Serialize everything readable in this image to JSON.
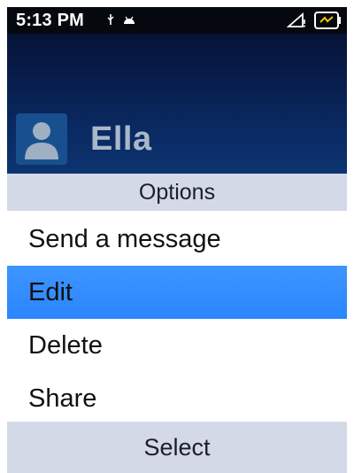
{
  "status_bar": {
    "time": "5:13 PM",
    "icons": [
      "usb-debug-icon",
      "android-icon",
      "signal-icon",
      "battery-charging-icon"
    ]
  },
  "contact": {
    "name": "Ella",
    "avatar_icon": "person-icon"
  },
  "options": {
    "title": "Options"
  },
  "menu": {
    "items": [
      {
        "label": "Send a message",
        "selected": false
      },
      {
        "label": "Edit",
        "selected": true
      },
      {
        "label": "Delete",
        "selected": false
      },
      {
        "label": "Share",
        "selected": false
      }
    ]
  },
  "softkey": {
    "center_label": "Select"
  },
  "colors": {
    "header_top": "#061337",
    "header_bottom": "#0c3470",
    "selection": "#2a86ff",
    "bar_bg": "#d4d9e8",
    "battery_accent": "#f2c200"
  }
}
